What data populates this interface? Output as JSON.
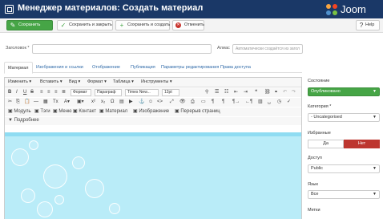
{
  "header": {
    "title": "Менеджер материалов: Создать материал",
    "logo_text": "Joom"
  },
  "toolbar": {
    "save": "Сохранить",
    "save_close": "Сохранить и закрыть",
    "save_new": "Сохранить и создать",
    "cancel": "Отменить",
    "help": "Help"
  },
  "form": {
    "title_label": "Заголовок *",
    "title_value": "",
    "alias_label": "Алиас",
    "alias_placeholder": "Автоматически создаётся из загол"
  },
  "tabs": [
    "Материал",
    "Изображения и ссылки",
    "Отображение",
    "Публикация",
    "Параметры редактирования",
    "Права доступа"
  ],
  "editor": {
    "menus": [
      "Изменить ▾",
      "Вставить ▾",
      "Вид ▾",
      "Формат ▾",
      "Таблица ▾",
      "Инструменты ▾"
    ],
    "formats": "Формат",
    "paragraph": "Параграф",
    "font": "Times New...",
    "size": "12pt",
    "buttons": [
      "Модуль",
      "Тэги",
      "Меню",
      "Контакт",
      "Материал",
      "Изображение",
      "Перерыв страниц",
      "Подробнее"
    ]
  },
  "sidebar": {
    "status_label": "Состояние",
    "status_value": "Опубликовано",
    "category_label": "Категория *",
    "category_value": "- Uncategorised",
    "featured_label": "Избранные",
    "featured_yes": "Да",
    "featured_no": "Нет",
    "access_label": "Доступ",
    "access_value": "Public",
    "language_label": "Язык",
    "language_value": "Все",
    "tags_label": "Метки"
  },
  "colors": {
    "header_bg": "#1a3867",
    "save_green": "#46a546",
    "no_red": "#bd362f",
    "editor_bg": "#b9ecf8"
  }
}
